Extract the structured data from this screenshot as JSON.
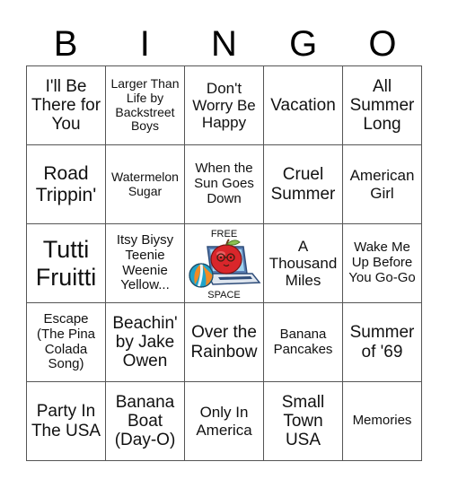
{
  "header": {
    "letters": [
      "B",
      "I",
      "N",
      "G",
      "O"
    ]
  },
  "board": {
    "rows": [
      [
        "I'll Be There for You",
        "Larger Than Life by Backstreet Boys",
        "Don't Worry Be Happy",
        "Vacation",
        "All Summer Long"
      ],
      [
        "Road Trippin'",
        "Watermelon Sugar",
        "When the Sun Goes Down",
        "Cruel Summer",
        "American Girl"
      ],
      [
        "Tutti Fruitti",
        "Itsy Biysy Teenie Weenie Yellow...",
        "FREE SPACE",
        "A Thousand Miles",
        "Wake Me Up Before You Go-Go"
      ],
      [
        "Escape (The Pina Colada Song)",
        "Beachin' by Jake Owen",
        "Over the Rainbow",
        "Banana Pancakes",
        "Summer of '69"
      ],
      [
        "Party In The USA",
        "Banana Boat (Day-O)",
        "Only In America",
        "Small Town USA",
        "Memories"
      ]
    ],
    "free_space": {
      "top_label": "FREE",
      "bottom_label": "SPACE",
      "icon": "apple-laptop-beachball-icon"
    }
  },
  "colors": {
    "grid_line": "#555555",
    "text": "#111111",
    "apple_red": "#d9262b",
    "laptop_blue": "#4a6fa5",
    "ball_orange": "#f08a24",
    "ball_teal": "#1fa3c9"
  }
}
